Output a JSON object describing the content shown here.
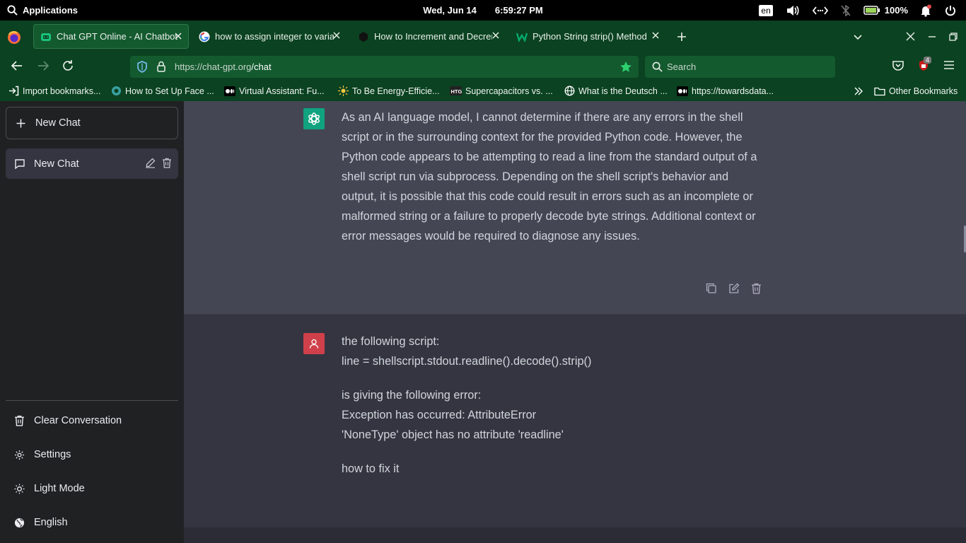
{
  "topbar": {
    "applications": "Applications",
    "date": "Wed, Jun 14",
    "time": "6:59:27 PM",
    "lang": "en",
    "battery": "100%"
  },
  "tabs": [
    {
      "title": "Chat GPT Online - AI Chatbot",
      "active": true
    },
    {
      "title": "how to assign integer to varia",
      "active": false
    },
    {
      "title": "How to Increment and Decrem",
      "active": false
    },
    {
      "title": "Python String strip() Method",
      "active": false
    }
  ],
  "address": {
    "host": "https://chat-gpt.org",
    "path": "/chat",
    "search_placeholder": "Search",
    "extension_badge": "4"
  },
  "bookmarks": [
    "Import bookmarks...",
    "How to Set Up Face ...",
    "Virtual Assistant: Fu...",
    "To Be Energy-Efficie...",
    "Supercapacitors vs. ...",
    "What is the Deutsch ...",
    "https://towardsdata...",
    "Other Bookmarks"
  ],
  "sidebar": {
    "new_chat_button": "New Chat",
    "chats": [
      {
        "title": "New Chat"
      }
    ],
    "clear": "Clear Conversation",
    "settings": "Settings",
    "theme": "Light Mode",
    "language": "English"
  },
  "conversation": {
    "assistant_message": "As an AI language model, I cannot determine if there are any errors in the shell script or in the surrounding context for the provided Python code. However, the Python code appears to be attempting to read a line from the standard output of a shell script run via subprocess. Depending on the shell script's behavior and output, it is possible that this code could result in errors such as an incomplete or malformed string or a failure to properly decode byte strings. Additional context or error messages would be required to diagnose any issues.",
    "user_message": {
      "line1": "the following script:",
      "line2": "line = shellscript.stdout.readline().decode().strip()",
      "line3": "is giving the following error:",
      "line4": "Exception has occurred: AttributeError",
      "line5": "'NoneType' object has no attribute 'readline'",
      "line6": "how to fix it"
    }
  },
  "colors": {
    "accent": "#10a37f",
    "user_avatar": "#d0404a",
    "browser_chrome": "#0b4221"
  }
}
